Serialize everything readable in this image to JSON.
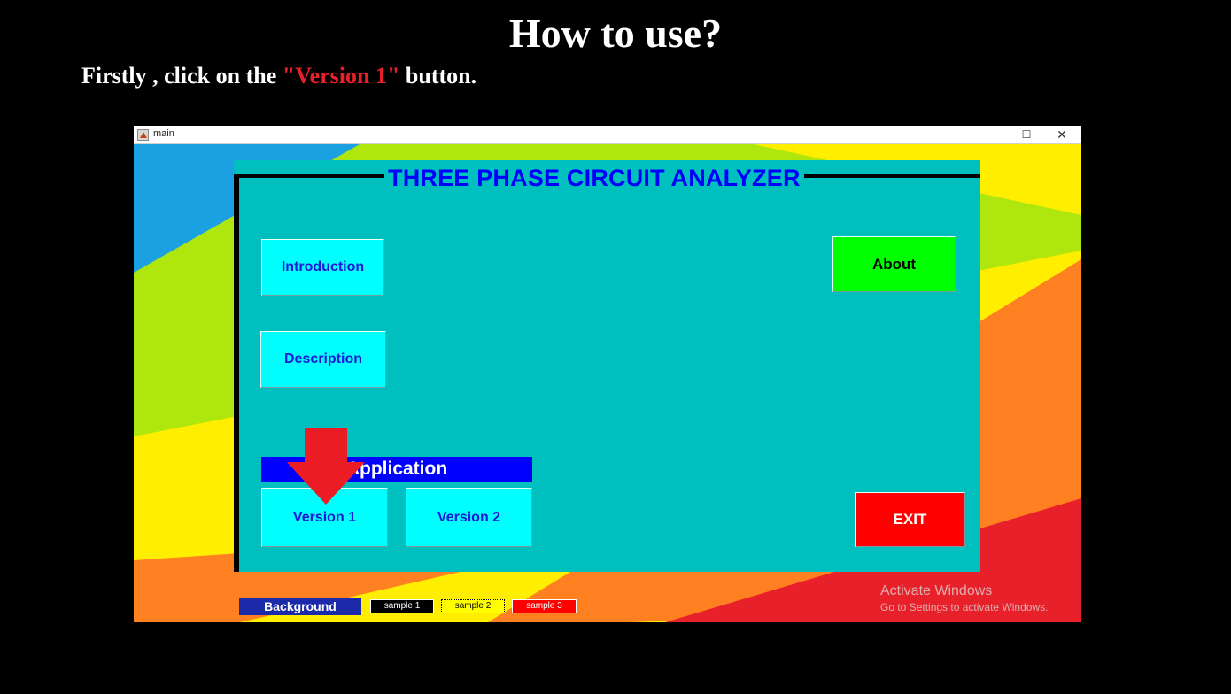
{
  "page": {
    "heading": "How to use?",
    "instruction_prefix": "Firstly , click on the ",
    "instruction_highlight": "\"Version 1\"",
    "instruction_suffix": " button."
  },
  "window": {
    "title": "main",
    "maximize_glyph": "☐",
    "close_glyph": "✕"
  },
  "app": {
    "title": "THREE PHASE CIRCUIT ANALYZER",
    "buttons": {
      "introduction": "Introduction",
      "description": "Description",
      "about": "About",
      "version1": "Version 1",
      "version2": "Version 2",
      "exit": "EXIT"
    },
    "application_label": "Application",
    "background_label": "Background",
    "samples": [
      "sample 1",
      "sample 2",
      "sample 3"
    ]
  },
  "watermark": {
    "line1": "Activate Windows",
    "line2": "Go to Settings to activate Windows."
  },
  "colors": {
    "panel": "#00bfbf",
    "cyan_button": "#00ffff",
    "about_button": "#00ff00",
    "exit_button": "#ff0000",
    "highlight_text": "#e8202a",
    "arrow": "#ec1c24"
  },
  "icons": {
    "pointer": "down-arrow-icon",
    "app": "matlab-icon"
  }
}
